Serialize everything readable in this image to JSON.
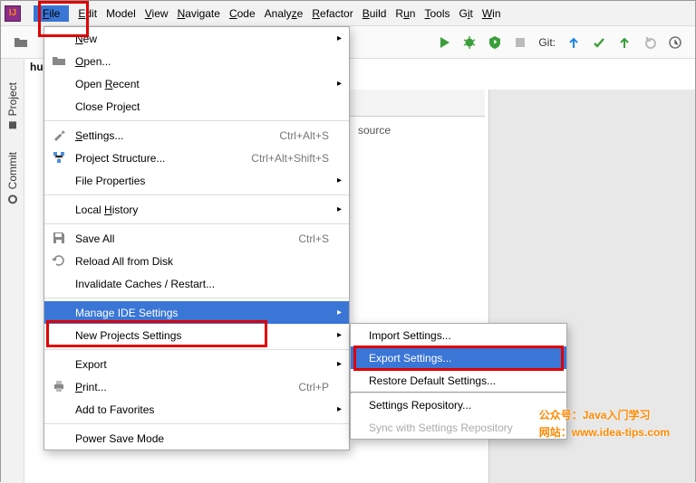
{
  "menubar": {
    "items": [
      "File",
      "Edit",
      "Model",
      "View",
      "Navigate",
      "Code",
      "Analyze",
      "Refactor",
      "Build",
      "Run",
      "Tools",
      "Git",
      "Win"
    ]
  },
  "toolbar": {
    "git_label": "Git:"
  },
  "left_tabs": {
    "project": "Project",
    "commit": "Commit"
  },
  "crumb": "hu",
  "editor_stub": "source",
  "file_menu": {
    "new": "New",
    "open": "Open...",
    "open_recent": "Open Recent",
    "close_project": "Close Project",
    "settings": "Settings...",
    "settings_sc": "Ctrl+Alt+S",
    "proj_structure": "Project Structure...",
    "proj_structure_sc": "Ctrl+Alt+Shift+S",
    "file_props": "File Properties",
    "local_history": "Local History",
    "save_all": "Save All",
    "save_all_sc": "Ctrl+S",
    "reload": "Reload All from Disk",
    "invalidate": "Invalidate Caches / Restart...",
    "manage_ide": "Manage IDE Settings",
    "new_proj_settings": "New Projects Settings",
    "export": "Export",
    "print": "Print...",
    "print_sc": "Ctrl+P",
    "add_fav": "Add to Favorites",
    "power_save": "Power Save Mode"
  },
  "submenu": {
    "import": "Import Settings...",
    "export": "Export Settings...",
    "restore": "Restore Default Settings...",
    "repo": "Settings Repository...",
    "sync": "Sync with Settings Repository"
  },
  "watermark": {
    "line1": "公众号：Java入门学习",
    "line2": "网站：www.idea-tips.com"
  }
}
